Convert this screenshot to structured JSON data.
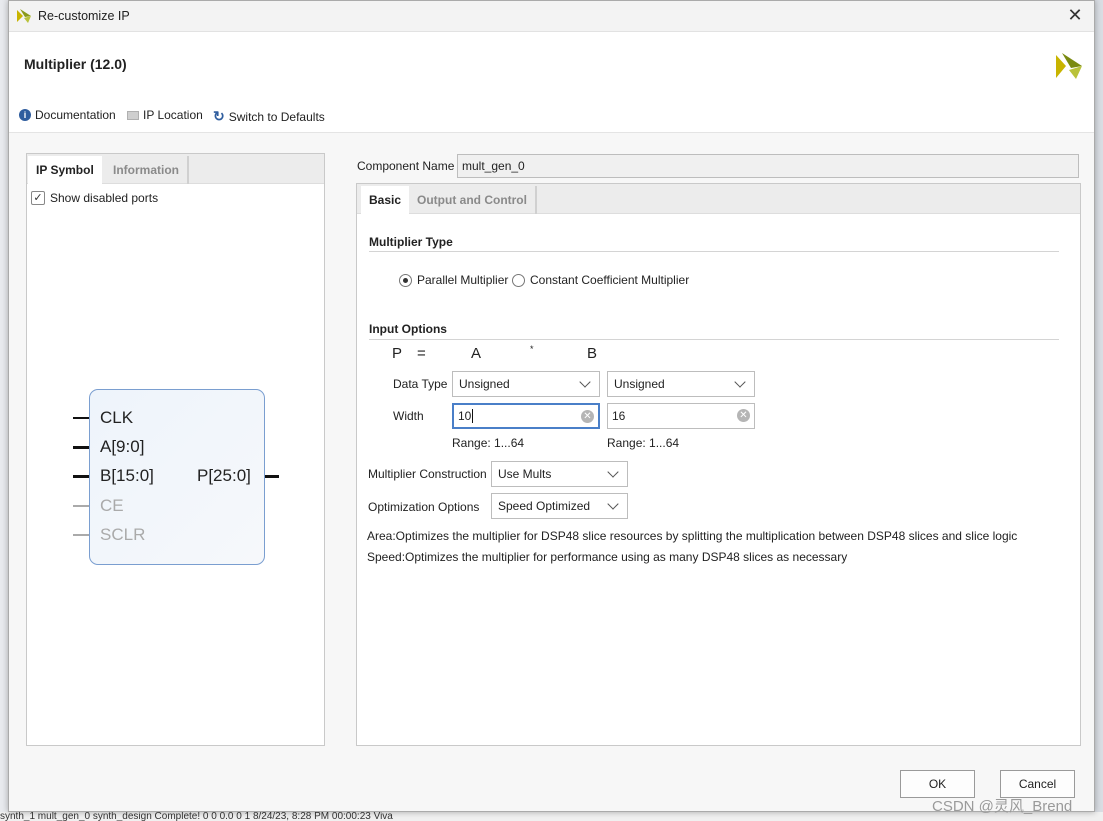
{
  "window": {
    "title": "Re-customize IP",
    "close_icon": "close-icon"
  },
  "header": {
    "ip_title": "Multiplier (12.0)",
    "brand_logo": "xilinx-logo"
  },
  "toolbar": {
    "documentation": "Documentation",
    "ip_location": "IP Location",
    "switch_defaults": "Switch to Defaults"
  },
  "left_panel": {
    "tabs": [
      {
        "label": "IP Symbol",
        "active": true
      },
      {
        "label": "Information",
        "active": false
      }
    ],
    "show_disabled_ports": {
      "label": "Show disabled ports",
      "checked": true
    },
    "symbol": {
      "inputs": [
        {
          "name": "CLK",
          "enabled": true
        },
        {
          "name": "A[9:0]",
          "enabled": true
        },
        {
          "name": "B[15:0]",
          "enabled": true
        },
        {
          "name": "CE",
          "enabled": false
        },
        {
          "name": "SCLR",
          "enabled": false
        }
      ],
      "output": "P[25:0]"
    }
  },
  "component": {
    "label": "Component Name",
    "value": "mult_gen_0"
  },
  "right_panel": {
    "tabs": [
      {
        "label": "Basic",
        "active": true
      },
      {
        "label": "Output and Control",
        "active": false
      }
    ],
    "multiplier_type": {
      "heading": "Multiplier Type",
      "options": [
        {
          "label": "Parallel Multiplier",
          "selected": true
        },
        {
          "label": "Constant Coefficient Multiplier",
          "selected": false
        }
      ]
    },
    "input_options": {
      "heading": "Input Options",
      "equation": {
        "p": "P",
        "eq": "=",
        "a": "A",
        "op": "*",
        "b": "B"
      },
      "data_type_label": "Data Type",
      "data_type_a": "Unsigned",
      "data_type_b": "Unsigned",
      "width_label": "Width",
      "width_a": "10",
      "width_b": "16",
      "range_a": "Range: 1...64",
      "range_b": "Range: 1...64"
    },
    "construction": {
      "label": "Multiplier Construction",
      "value": "Use Mults"
    },
    "optimization": {
      "label": "Optimization Options",
      "value": "Speed Optimized"
    },
    "desc_area": "Area:Optimizes the multiplier for DSP48 slice resources by splitting the multiplication between DSP48 slices and slice logic",
    "desc_speed": "Speed:Optimizes the multiplier for performance using as many DSP48 slices as necessary"
  },
  "buttons": {
    "ok": "OK",
    "cancel": "Cancel"
  },
  "background_status": "synth_1    mult_gen_0    synth_design Complete!                                                                                                   0      0      0.0      0      1    8/24/23, 8:28 PM    00:00:23    Viva",
  "watermark": "CSDN @灵风_Brend"
}
